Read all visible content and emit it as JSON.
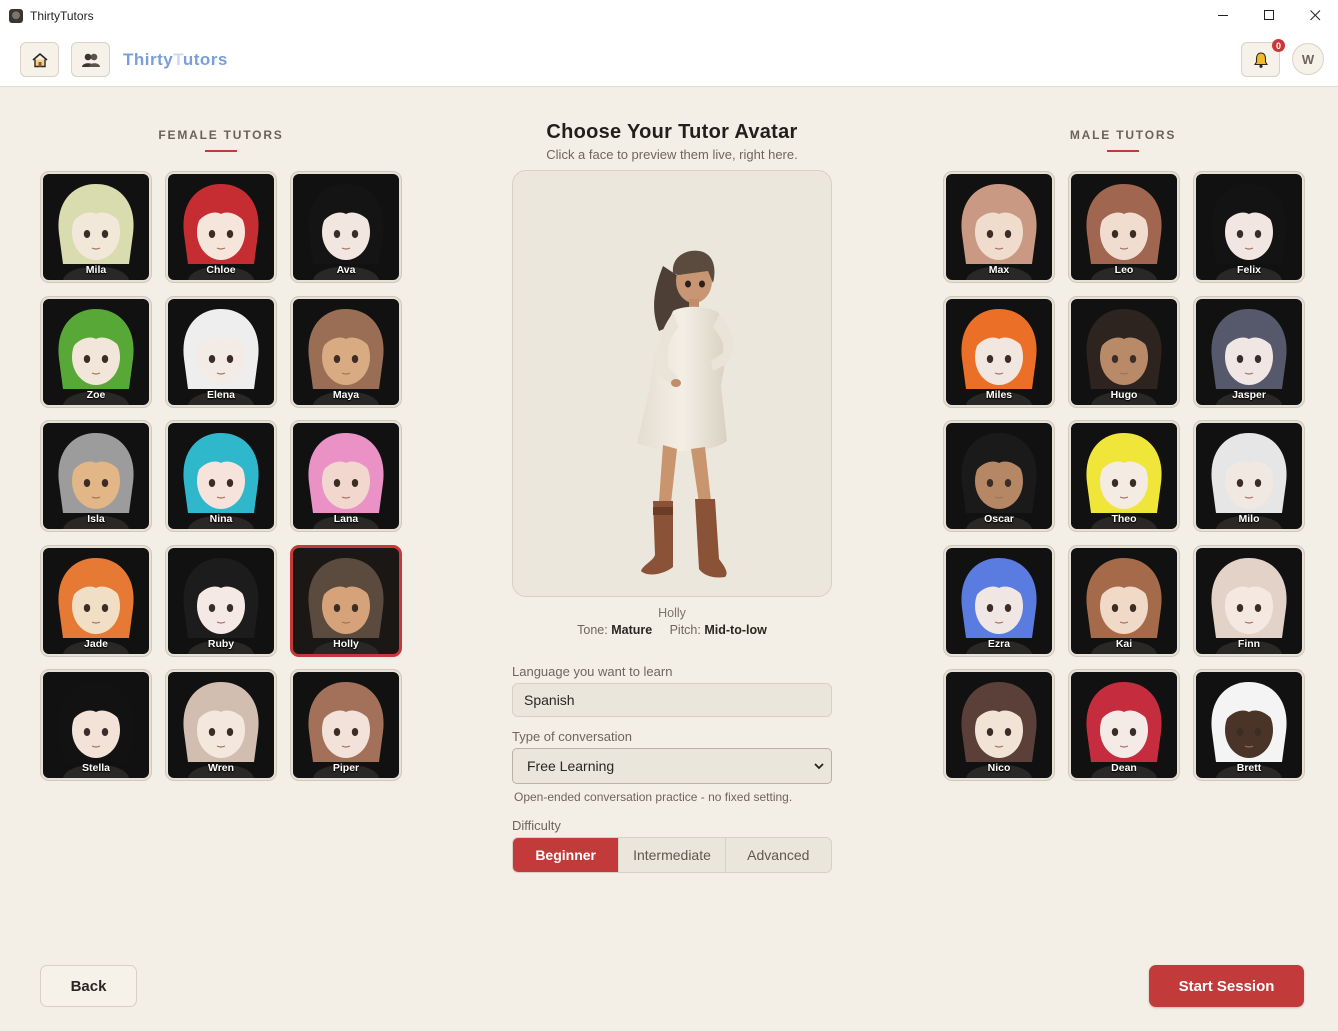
{
  "window": {
    "title": "ThirtyTutors",
    "minimize_glyph": "—",
    "maximize_glyph": "☐",
    "close_glyph": "✕"
  },
  "header": {
    "brand": "Thirty",
    "brand_tail": "utors",
    "brand_faded": "T",
    "home_icon": "home-icon",
    "people_icon": "people-icon",
    "notification_count": "0",
    "user_initial": "W"
  },
  "female": {
    "heading": "FEMALE TUTORS",
    "tutors": [
      {
        "name": "Mila",
        "hair": "#d9dcae",
        "skin": "#f1e8da"
      },
      {
        "name": "Chloe",
        "hair": "#c62d33",
        "skin": "#f5e5da"
      },
      {
        "name": "Ava",
        "hair": "#141414",
        "skin": "#f2e7e0"
      },
      {
        "name": "Zoe",
        "hair": "#58a838",
        "skin": "#f1e6d9"
      },
      {
        "name": "Elena",
        "hair": "#eeeeee",
        "skin": "#f3ebe6"
      },
      {
        "name": "Maya",
        "hair": "#9a6e55",
        "skin": "#d9ab82"
      },
      {
        "name": "Isla",
        "hair": "#9c9c9c",
        "skin": "#e2b686"
      },
      {
        "name": "Nina",
        "hair": "#2fb8cc",
        "skin": "#f6e3dc"
      },
      {
        "name": "Lana",
        "hair": "#ea92c6",
        "skin": "#f2d7cf"
      },
      {
        "name": "Jade",
        "hair": "#e67a34",
        "skin": "#f1dfc5"
      },
      {
        "name": "Ruby",
        "hair": "#1c1c1c",
        "skin": "#f4e9e4"
      },
      {
        "name": "Holly",
        "hair": "#5b4a3e",
        "skin": "#d5a27a"
      },
      {
        "name": "Stella",
        "hair": "#121212",
        "skin": "#f2e2d8"
      },
      {
        "name": "Wren",
        "hair": "#d2beb0",
        "skin": "#f4e8de"
      },
      {
        "name": "Piper",
        "hair": "#a3715a",
        "skin": "#f3e2da"
      }
    ]
  },
  "male": {
    "heading": "MALE TUTORS",
    "tutors": [
      {
        "name": "Max",
        "hair": "#c99983",
        "skin": "#efdccd"
      },
      {
        "name": "Leo",
        "hair": "#a06650",
        "skin": "#f0ddd0"
      },
      {
        "name": "Felix",
        "hair": "#131313",
        "skin": "#f1e6e1"
      },
      {
        "name": "Miles",
        "hair": "#ec6f27",
        "skin": "#f1e6e0"
      },
      {
        "name": "Hugo",
        "hair": "#2d241f",
        "skin": "#b98a68"
      },
      {
        "name": "Jasper",
        "hair": "#56586b",
        "skin": "#f0e6e3"
      },
      {
        "name": "Oscar",
        "hair": "#1a1a1a",
        "skin": "#b68764"
      },
      {
        "name": "Theo",
        "hair": "#f0e63a",
        "skin": "#f4ebe2"
      },
      {
        "name": "Milo",
        "hair": "#e6e6e6",
        "skin": "#f2e8e2"
      },
      {
        "name": "Ezra",
        "hair": "#5a7be0",
        "skin": "#f0e6e3"
      },
      {
        "name": "Kai",
        "hair": "#a46a4a",
        "skin": "#f0d9c6"
      },
      {
        "name": "Finn",
        "hair": "#e3d2c7",
        "skin": "#f4e8e1"
      },
      {
        "name": "Nico",
        "hair": "#5a4038",
        "skin": "#f1e3d6"
      },
      {
        "name": "Dean",
        "hair": "#c52d3e",
        "skin": "#f4ebe6"
      },
      {
        "name": "Brett",
        "hair": "#f4f4f4",
        "skin": "#4a3327"
      }
    ]
  },
  "center": {
    "title": "Choose Your Tutor Avatar",
    "subtitle": "Click a face to preview them live, right here.",
    "preview_name": "Holly",
    "tone_label": "Tone:",
    "tone_value": "Mature",
    "pitch_label": "Pitch:",
    "pitch_value": "Mid-to-low",
    "language_label": "Language you want to learn",
    "language_value": "Spanish",
    "conversation_label": "Type of conversation",
    "conversation_value": "Free Learning",
    "conversation_hint": "Open-ended conversation practice - no fixed setting.",
    "difficulty_label": "Difficulty",
    "difficulty_options": [
      "Beginner",
      "Intermediate",
      "Advanced"
    ]
  },
  "footer": {
    "back_label": "Back",
    "start_label": "Start Session"
  },
  "colors": {
    "accent": "#c23a3a",
    "background": "#f3efe6",
    "brand": "#7a9fd8"
  }
}
